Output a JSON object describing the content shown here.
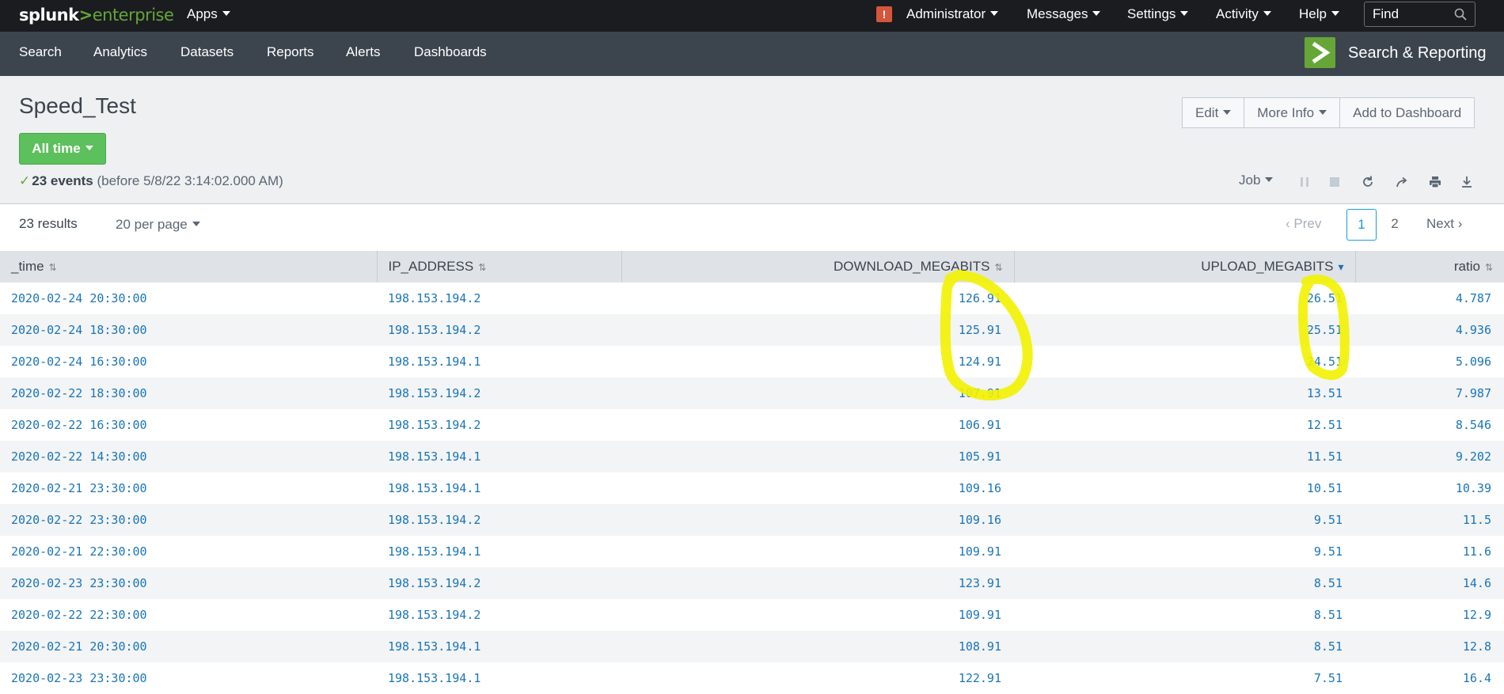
{
  "topbar": {
    "logo_word": "splunk",
    "logo_sep": ">",
    "logo_product": "enterprise",
    "apps": "Apps",
    "user": "Administrator",
    "messages": "Messages",
    "settings": "Settings",
    "activity": "Activity",
    "help": "Help",
    "find_placeholder": "Find",
    "alert_glyph": "!"
  },
  "appbar": {
    "nav": [
      "Search",
      "Analytics",
      "Datasets",
      "Reports",
      "Alerts",
      "Dashboards"
    ],
    "app_name": "Search & Reporting"
  },
  "header": {
    "title": "Speed_Test",
    "time_range": "All time",
    "buttons": {
      "edit": "Edit",
      "more_info": "More Info",
      "add_to_dashboard": "Add to Dashboard"
    },
    "events_count": "23 events",
    "events_note": "(before 5/8/22 3:14:02.000 AM)",
    "job": "Job"
  },
  "results_bar": {
    "count": "23 results",
    "per_page": "20 per page",
    "prev": "Prev",
    "pages": [
      "1",
      "2"
    ],
    "current_page": "1",
    "next": "Next"
  },
  "table": {
    "columns": [
      "_time",
      "IP_ADDRESS",
      "DOWNLOAD_MEGABITS",
      "UPLOAD_MEGABITS",
      "ratio"
    ],
    "sorted_column": "UPLOAD_MEGABITS",
    "sort_direction": "descending",
    "rows": [
      [
        "2020-02-24 20:30:00",
        "198.153.194.2",
        "126.91",
        "26.51",
        "4.787"
      ],
      [
        "2020-02-24 18:30:00",
        "198.153.194.2",
        "125.91",
        "25.51",
        "4.936"
      ],
      [
        "2020-02-24 16:30:00",
        "198.153.194.1",
        "124.91",
        "24.51",
        "5.096"
      ],
      [
        "2020-02-22 18:30:00",
        "198.153.194.2",
        "107.91",
        "13.51",
        "7.987"
      ],
      [
        "2020-02-22 16:30:00",
        "198.153.194.2",
        "106.91",
        "12.51",
        "8.546"
      ],
      [
        "2020-02-22 14:30:00",
        "198.153.194.1",
        "105.91",
        "11.51",
        "9.202"
      ],
      [
        "2020-02-21 23:30:00",
        "198.153.194.1",
        "109.16",
        "10.51",
        "10.39"
      ],
      [
        "2020-02-22 23:30:00",
        "198.153.194.2",
        "109.16",
        "9.51",
        "11.5"
      ],
      [
        "2020-02-21 22:30:00",
        "198.153.194.1",
        "109.91",
        "9.51",
        "11.6"
      ],
      [
        "2020-02-23 23:30:00",
        "198.153.194.2",
        "123.91",
        "8.51",
        "14.6"
      ],
      [
        "2020-02-22 22:30:00",
        "198.153.194.2",
        "109.91",
        "8.51",
        "12.9"
      ],
      [
        "2020-02-21 20:30:00",
        "198.153.194.1",
        "108.91",
        "8.51",
        "12.8"
      ],
      [
        "2020-02-23 23:30:00",
        "198.153.194.1",
        "122.91",
        "7.51",
        "16.4"
      ]
    ]
  },
  "colors": {
    "topbar_bg": "#1a1c20",
    "appbar_bg": "#3c444d",
    "brand_green": "#65a637",
    "time_button": "#5cc05c",
    "link_blue": "#1a75b8",
    "highlight_yellow": "#f2f200"
  },
  "annotation": {
    "type": "hand-drawn yellow circles",
    "marks": [
      "around DOWNLOAD_MEGABITS of first three rows",
      "around UPLOAD_MEGABITS of first three rows"
    ]
  }
}
